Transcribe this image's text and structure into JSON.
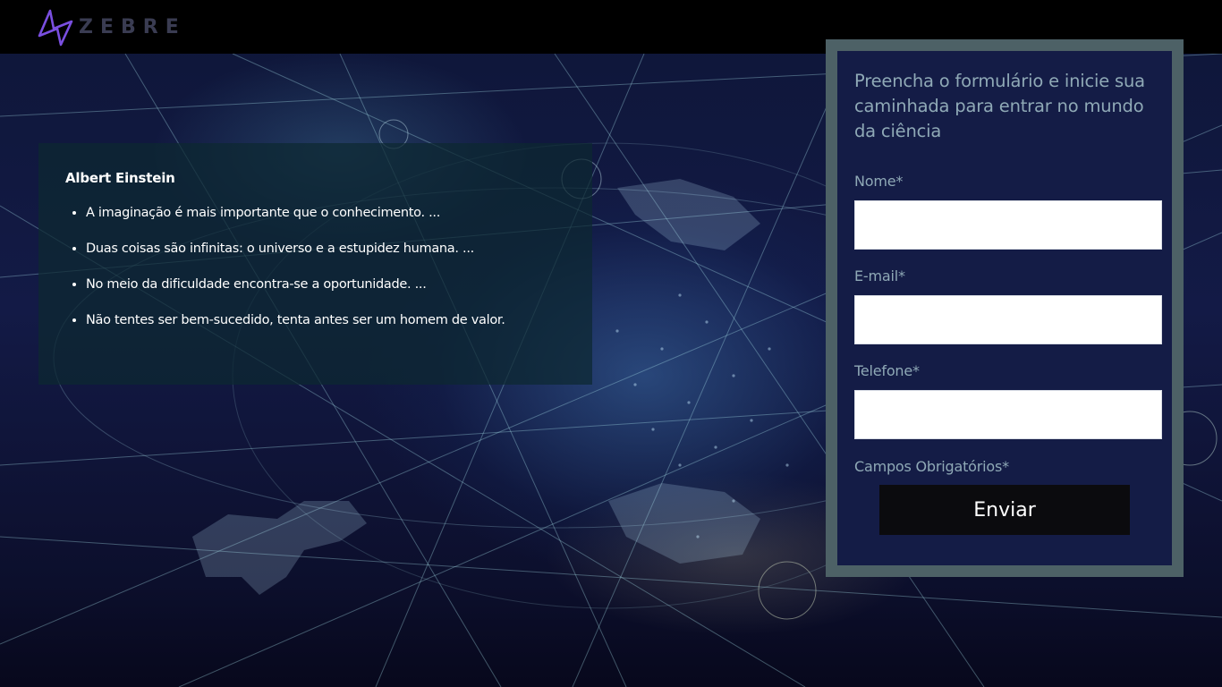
{
  "brand": {
    "name": "ZEBRE",
    "mark_color": "#7a4fe0",
    "text_color": "#3a3c52"
  },
  "quote": {
    "author": "Albert Einstein",
    "items": [
      "A imaginação é mais importante que o conhecimento. ...",
      "Duas coisas são infinitas: o universo e a estupidez humana. ...",
      "No meio da dificuldade encontra-se a oportunidade. ...",
      "Não tentes ser bem-sucedido, tenta antes ser um homem de valor."
    ]
  },
  "form": {
    "heading": "Preencha o formulário e inicie sua caminhada para entrar no mundo da ciência",
    "fields": [
      {
        "label": "Nome*",
        "value": ""
      },
      {
        "label": "E-mail*",
        "value": ""
      },
      {
        "label": "Telefone*",
        "value": ""
      }
    ],
    "required_note": "Campos Obrigatórios*",
    "submit_label": "Enviar"
  },
  "colors": {
    "topbar": "#000000",
    "form_frame": "#4d6166",
    "form_card": "#141c46",
    "form_text": "#8fa9b6",
    "button": "#0b0b0e"
  }
}
